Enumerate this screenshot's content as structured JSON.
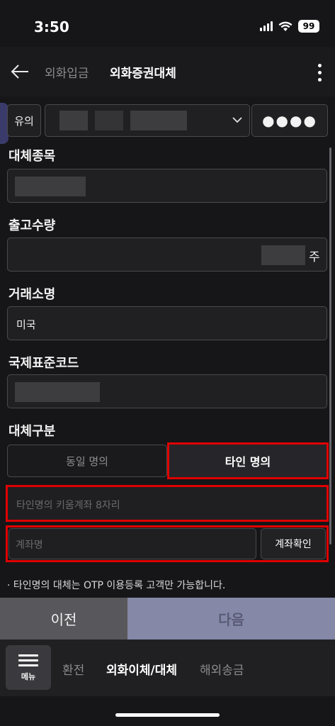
{
  "status": {
    "time": "3:50",
    "battery": "99"
  },
  "header": {
    "tabs": [
      {
        "label": "외화입금"
      },
      {
        "label": "외화증권대체"
      }
    ]
  },
  "account": {
    "type_label": "유의",
    "password_mask": "●●●●"
  },
  "fields": {
    "symbol_label": "대체종목",
    "quantity_label": "출고수량",
    "quantity_unit": "주",
    "exchange_label": "거래소명",
    "exchange_value": "미국",
    "isin_label": "국제표준코드",
    "type_label": "대체구분",
    "option_same": "동일 명의",
    "option_other": "타인 명의",
    "other_account_placeholder": "타인명의 키움계좌 8자리",
    "account_name_placeholder": "계좌명",
    "confirm_button": "계좌확인",
    "notice": "· 타인명의 대체는 OTP 이용등록 고객만 가능합니다."
  },
  "actions": {
    "prev": "이전",
    "next": "다음"
  },
  "bottom_nav": {
    "menu_label": "메뉴",
    "items": [
      {
        "label": "환전"
      },
      {
        "label": "외화이체/대체"
      },
      {
        "label": "해외송금"
      }
    ]
  },
  "colors": {
    "highlight": "#e00000",
    "next_button": "#8688a8",
    "background": "#161618"
  }
}
